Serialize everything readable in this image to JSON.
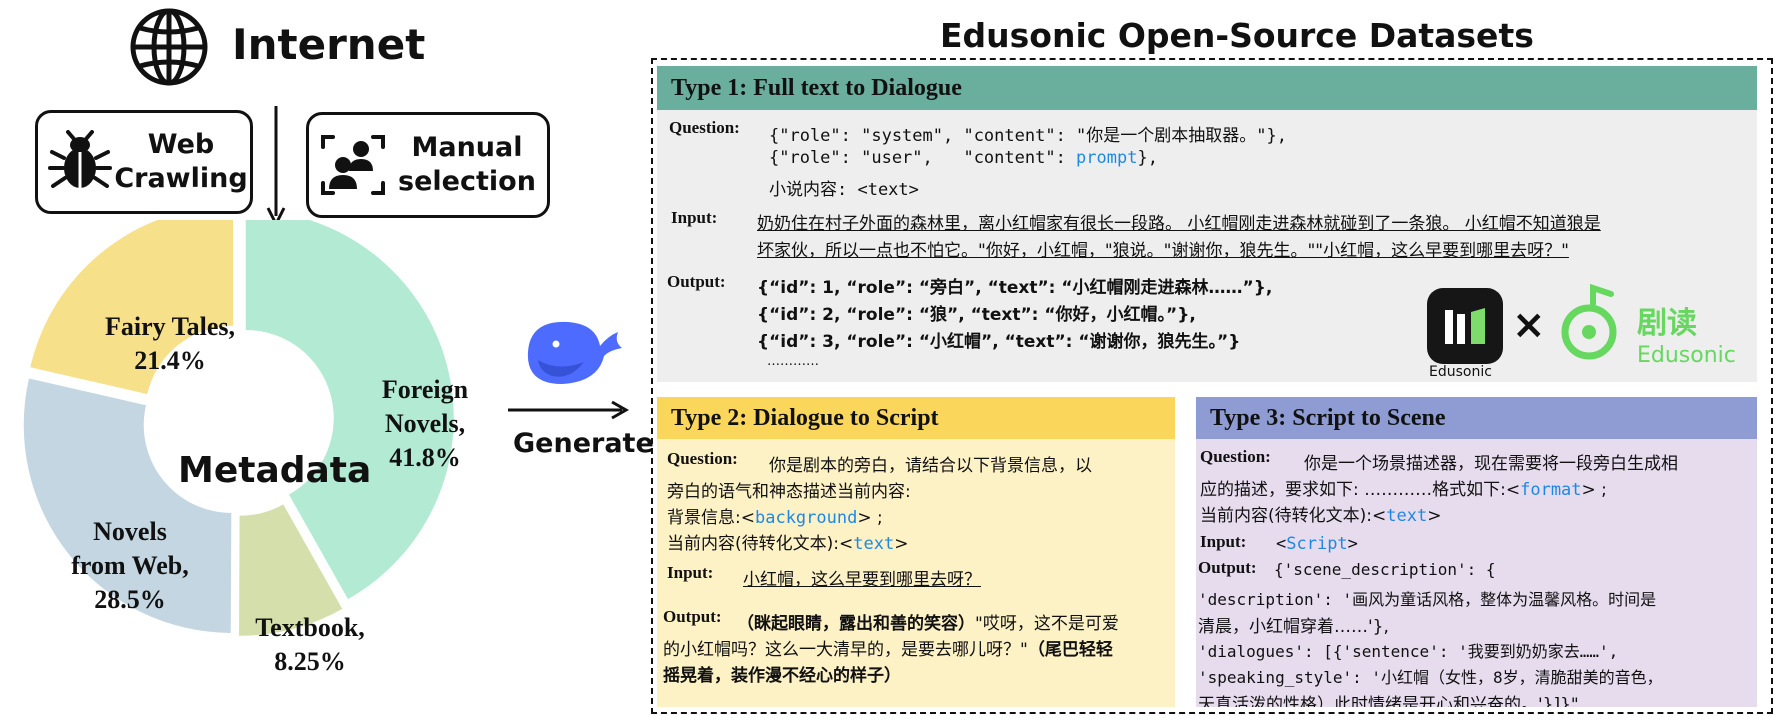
{
  "source": {
    "title": "Internet",
    "icon": "globe-icon",
    "methods": [
      {
        "label_lines": [
          "Web",
          "Crawling"
        ],
        "icon": "bug-icon"
      },
      {
        "label_lines": [
          "Manual",
          "selection"
        ],
        "icon": "people-icon"
      }
    ]
  },
  "donut": {
    "center_label": "Metadata",
    "slices": [
      {
        "label_lines": [
          "Foreign",
          "Novels,",
          "41.8%"
        ],
        "value": 41.8,
        "color": "#b3ead4"
      },
      {
        "label_lines": [
          "Textbook,",
          "8.25%"
        ],
        "value": 8.25,
        "color": "#d5dfac"
      },
      {
        "label_lines": [
          "Novels",
          "from Web,",
          "28.5%"
        ],
        "value": 28.5,
        "color": "#c3d6e2"
      },
      {
        "label_lines": [
          "Fairy Tales,",
          "21.4%"
        ],
        "value": 21.4,
        "color": "#f6e08a"
      }
    ]
  },
  "generate": {
    "label": "Generate",
    "icon": "whale-icon"
  },
  "datasets": {
    "title": "Edusonic Open-Source Datasets",
    "type1": {
      "header": "Type 1: Full text to Dialogue",
      "question_label": "Question:",
      "q1": "{\"role\": \"system\", \"content\": \"你是一个剧本抽取器。\"},",
      "q2a": "{\"role\": \"user\",   \"content\": ",
      "q2kw": "prompt",
      "q2b": "},",
      "q3": "小说内容: <text>",
      "input_label": "Input:",
      "input1": "奶奶住在村子外面的森林里，离小红帽家有很长一段路。  小红帽刚走进森林就碰到了一条狼。  小红帽不知道狼是",
      "input2": "坏家伙，所以一点也不怕它。\"你好，小红帽，\"狼说。\"谢谢你，狼先生。\"\"小红帽，这么早要到哪里去呀？\"",
      "output_label": "Output:",
      "o1": "{“id”: 1, “role”: “旁白”, “text”: “小红帽刚走进森林……”},",
      "o2": "{“id”: 2, “role”: “狼”, “text”: “你好，小红帽。”},",
      "o3": "{“id”: 3, “role”: “小红帽”, “text”: “谢谢你，狼先生。”}",
      "o4": "…………",
      "logo_text": "Edusonic",
      "times": "×",
      "brand_cn": "剧读",
      "brand_en": "Edusonic"
    },
    "type2": {
      "header": "Type 2: Dialogue to Script",
      "question_label": "Question:",
      "q1": "你是剧本的旁白，请结合以下背景信息，以",
      "q2": "旁白的语气和神态描述当前内容:",
      "q3a": "背景信息:<",
      "q3kw": "background",
      "q3b": "> ;",
      "q4a": "当前内容(待转化文本):<",
      "q4kw": "text",
      "q4b": ">",
      "input_label": "Input:",
      "input": "小红帽，这么早要到哪里去呀？",
      "output_label": "Output:",
      "o1a": "（眯起眼睛，露出和善的笑容）",
      "o1b": "\"哎呀，这不是可爱",
      "o2": "的小红帽吗？这么一大清早的，是要去哪儿呀？\"",
      "o2b": "（尾巴轻轻",
      "o3": "摇晃着，装作漫不经心的样子）"
    },
    "type3": {
      "header": "Type 3: Script to Scene",
      "question_label": "Question:",
      "q1": "你是一个场景描述器，现在需要将一段旁白生成相",
      "q2a": "应的描述，要求如下: …………格式如下:<",
      "q2kw": "format",
      "q2b": "> ;",
      "q3a": "当前内容(待转化文本):<",
      "q3kw": "text",
      "q3b": ">",
      "input_label": "Input:",
      "input_a": "<",
      "input_kw": "Script",
      "input_b": ">",
      "output_label": "Output:",
      "o0": "{'scene_description': {",
      "o1": "'description': '画风为童话风格，整体为温馨风格。时间是",
      "o2": "清晨，小红帽穿着……'},",
      "o3": "'dialogues': [{'sentence': '我要到奶奶家去……',",
      "o4": "'speaking_style': '小红帽（女性，8岁，清脆甜美的音色，",
      "o5": "天真活泼的性格）此时情绪是开心和兴奋的。'}]}\""
    }
  },
  "colors": {
    "type1_header": "#6aae9d",
    "type1_body": "#eeeeee",
    "type2_header": "#fad65b",
    "type2_body": "#fdf1c6",
    "type3_header": "#8f9bd3",
    "type3_body": "#e7dcee",
    "keyword": "#1e88e5",
    "brand_green": "#66d85f"
  }
}
